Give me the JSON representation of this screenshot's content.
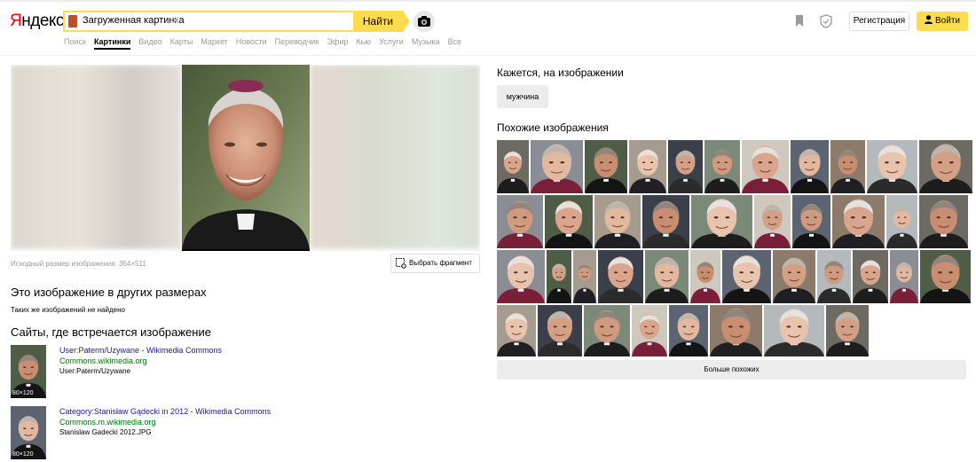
{
  "header": {
    "logo": "Яндекс",
    "logo_first_letter": "Я",
    "logo_rest": "ндекс",
    "search_chip": "Загруженная картинка",
    "find_label": "Найти",
    "register_label": "Регистрация",
    "login_label": "Войти",
    "accent_color": "#ffdb4d"
  },
  "tabs": [
    {
      "label": "Поиск",
      "active": false
    },
    {
      "label": "Картинки",
      "active": true
    },
    {
      "label": "Видео",
      "active": false
    },
    {
      "label": "Карты",
      "active": false
    },
    {
      "label": "Маркет",
      "active": false
    },
    {
      "label": "Новости",
      "active": false
    },
    {
      "label": "Переводчик",
      "active": false
    },
    {
      "label": "Эфир",
      "active": false
    },
    {
      "label": "Кью",
      "active": false
    },
    {
      "label": "Услуги",
      "active": false
    },
    {
      "label": "Музыка",
      "active": false
    },
    {
      "label": "Все",
      "active": false
    }
  ],
  "preview": {
    "original_size_text": "Исходный размер изображения: 354×511",
    "select_fragment_label": "Выбрать фрагмент"
  },
  "other_sizes": {
    "heading": "Это изображение в других размерах",
    "none_text": "Таких же изображений не найдено"
  },
  "sites": {
    "heading": "Сайты, где встречается изображение",
    "items": [
      {
        "title": "User:Paterm/Uzywane - Wikimedia Commons",
        "domain": "Commons.wikimedia.org",
        "desc": "User:Paterm/Uzywane",
        "dims": "80×120"
      },
      {
        "title": "Category:Stanisław Gądecki in 2012 - Wikimedia Commons",
        "domain": "Commons.m.wikimedia.org",
        "desc": "Stanislaw Gadecki 2012.JPG",
        "dims": "80×120"
      }
    ]
  },
  "seems": {
    "heading": "Кажется, на изображении",
    "tag": "мужчина"
  },
  "similar": {
    "heading": "Похожие изображения",
    "more_label": "Больше похожих",
    "count": 42
  },
  "icons": {
    "camera": "camera-icon",
    "bookmark": "bookmark-icon",
    "shield": "shield-icon",
    "user": "user-icon",
    "fragment": "crop-fragment-icon",
    "close": "close-icon"
  }
}
